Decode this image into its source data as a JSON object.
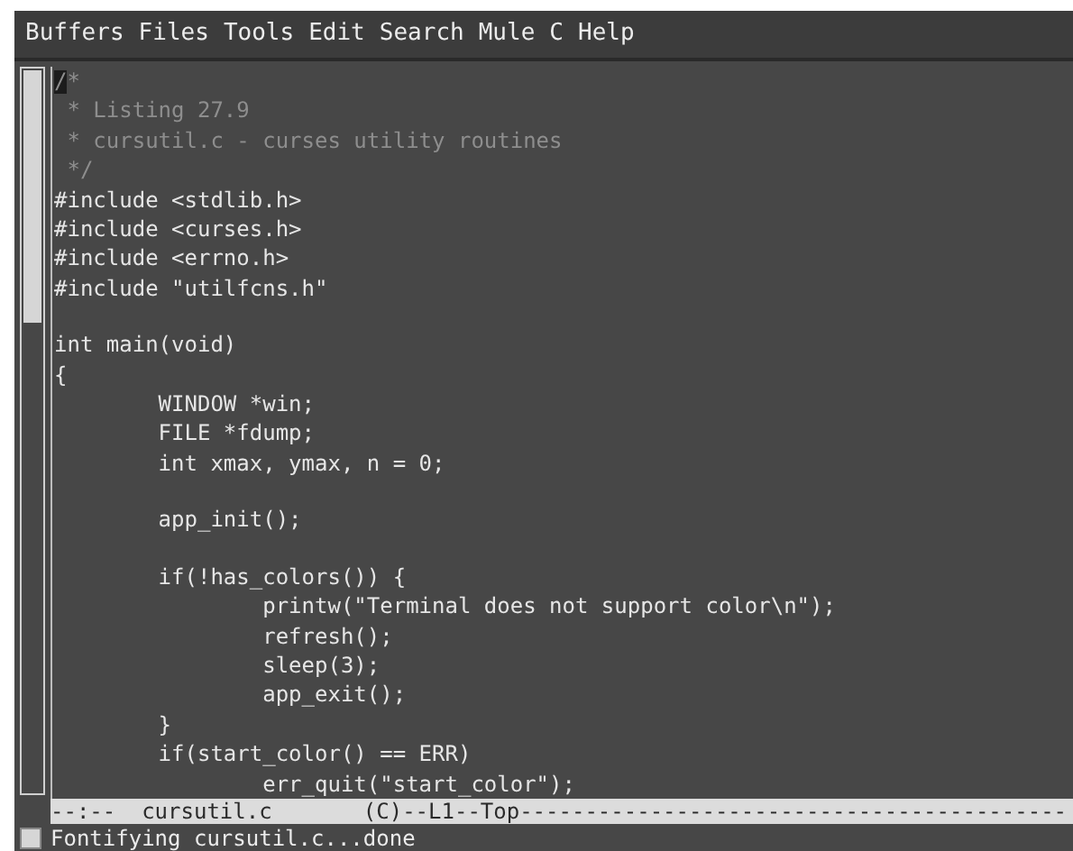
{
  "menu_bar": [
    "Buffers",
    "Files",
    "Tools",
    "Edit",
    "Search",
    "Mule",
    "C",
    "Help"
  ],
  "buffer": {
    "lines": [
      {
        "kind": "comment",
        "text": "/*",
        "cursor": true
      },
      {
        "kind": "comment",
        "text": " * Listing 27.9",
        "cursor": false
      },
      {
        "kind": "comment",
        "text": " * cursutil.c - curses utility routines",
        "cursor": false
      },
      {
        "kind": "comment",
        "text": " */",
        "cursor": false
      },
      {
        "kind": "code",
        "text": "#include <stdlib.h>",
        "cursor": false
      },
      {
        "kind": "code",
        "text": "#include <curses.h>",
        "cursor": false
      },
      {
        "kind": "code",
        "text": "#include <errno.h>",
        "cursor": false
      },
      {
        "kind": "code",
        "text": "#include \"utilfcns.h\"",
        "cursor": false
      },
      {
        "kind": "blank"
      },
      {
        "kind": "code",
        "text": "int main(void)",
        "cursor": false
      },
      {
        "kind": "code",
        "text": "{",
        "cursor": false
      },
      {
        "kind": "code",
        "text": "\tWINDOW *win;",
        "cursor": false
      },
      {
        "kind": "code",
        "text": "\tFILE *fdump;",
        "cursor": false
      },
      {
        "kind": "code",
        "text": "\tint xmax, ymax, n = 0;",
        "cursor": false
      },
      {
        "kind": "blank"
      },
      {
        "kind": "code",
        "text": "\tapp_init();",
        "cursor": false
      },
      {
        "kind": "blank"
      },
      {
        "kind": "code",
        "text": "\tif(!has_colors()) {",
        "cursor": false
      },
      {
        "kind": "code",
        "text": "\t\tprintw(\"Terminal does not support color\\n\");",
        "cursor": false
      },
      {
        "kind": "code",
        "text": "\t\trefresh();",
        "cursor": false
      },
      {
        "kind": "code",
        "text": "\t\tsleep(3);",
        "cursor": false
      },
      {
        "kind": "code",
        "text": "\t\tapp_exit();",
        "cursor": false
      },
      {
        "kind": "code",
        "text": "\t}",
        "cursor": false
      },
      {
        "kind": "code",
        "text": "\tif(start_color() == ERR)",
        "cursor": false
      },
      {
        "kind": "code",
        "text": "\t\terr_quit(\"start_color\");",
        "cursor": false
      }
    ]
  },
  "mode_line": "--:--  cursutil.c       (C)--L1--Top------------------------------------------",
  "echo_area": "Fontifying cursutil.c...done"
}
